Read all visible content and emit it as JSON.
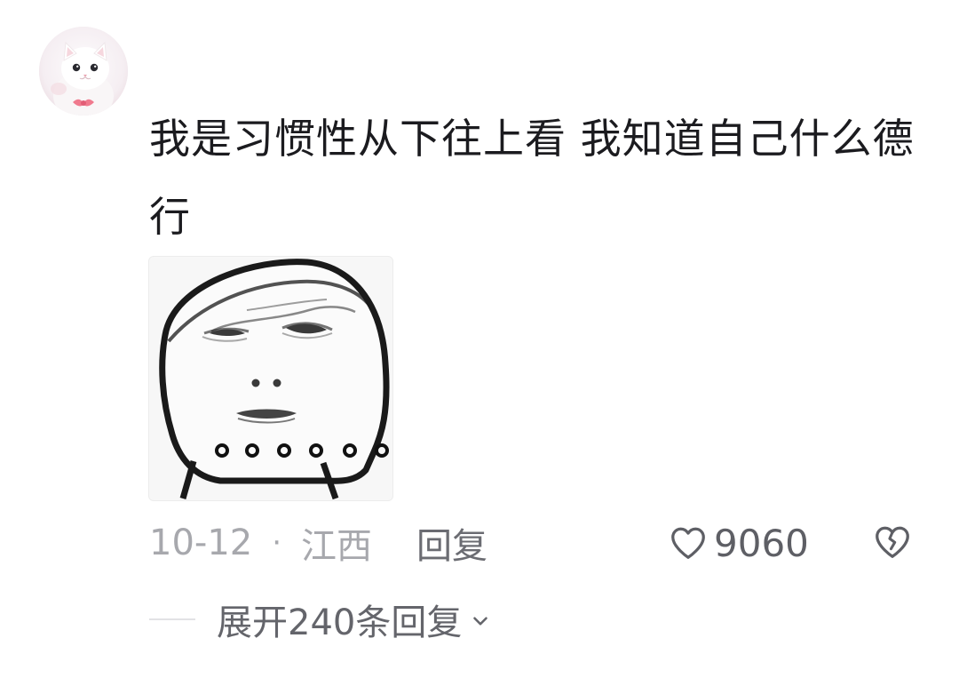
{
  "comment": {
    "avatar_icon": "kitten-avatar",
    "text": "我是习惯性从下往上看 我知道自己什么德行",
    "image_icon": "rage-face-meme",
    "date": "10-12",
    "separator": "·",
    "location": "江西",
    "reply_label": "回复",
    "likes": "9060",
    "like_icon": "heart-outline-icon",
    "dislike_icon": "broken-heart-icon",
    "expand_label": "展开240条回复"
  },
  "colors": {
    "primary_text": "#1b1b1f",
    "secondary_text": "#a7a8ad",
    "action_text": "#6b6c72"
  }
}
